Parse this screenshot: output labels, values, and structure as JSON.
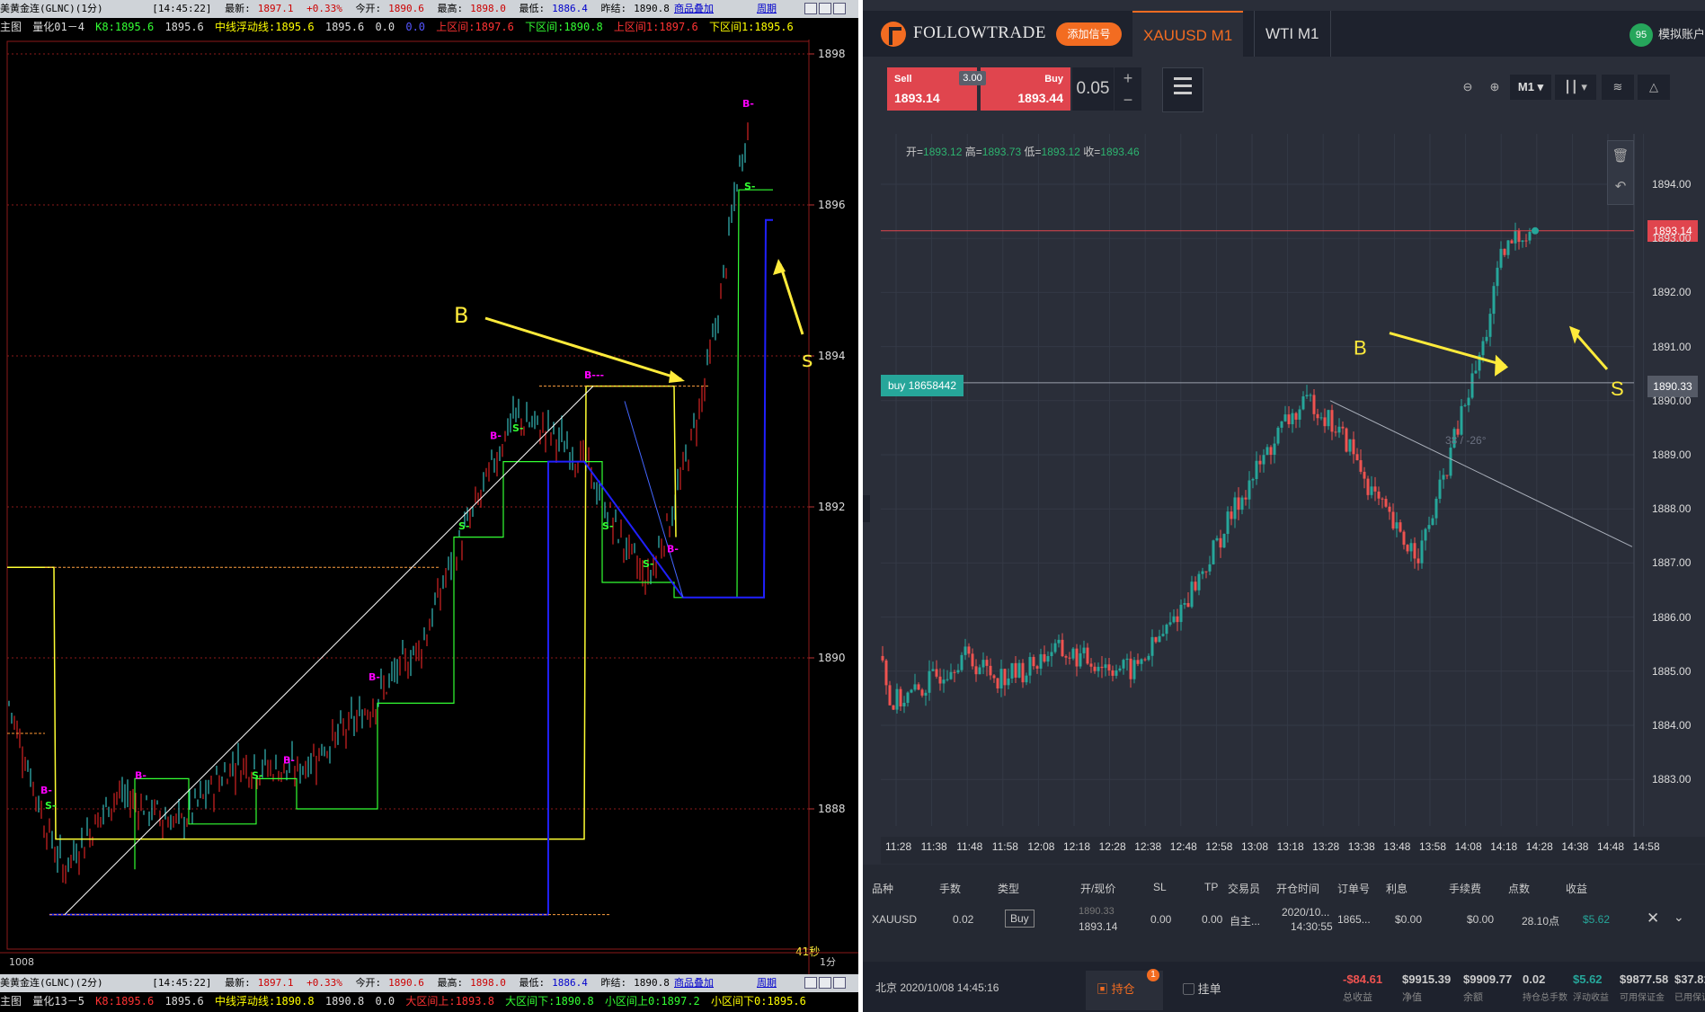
{
  "left": {
    "header1": {
      "title": "美黄金连(GLNC)(1分)",
      "time": "[14:45:22]",
      "latest_label": "最新:",
      "latest": "1897.1",
      "change": "+0.33%",
      "open_label": "今开:",
      "open": "1890.6",
      "high_label": "最高:",
      "high": "1898.0",
      "low_label": "最低:",
      "low": "1886.4",
      "prev_label": "昨结:",
      "prev": "1890.8",
      "overlay_btn": "商品叠加",
      "period_btn": "周期"
    },
    "indicator1": {
      "main": "主图",
      "name": "量化01－4",
      "k8": "K8:1895.6",
      "v1": "1895.6",
      "mid": "中线浮动线:1895.6",
      "v2": "1895.6",
      "v3": "0.0",
      "v4": "0.0",
      "upper": "上区间:1897.6",
      "lower": "下区间:1890.8",
      "upper1": "上区间1:1897.6",
      "lower1": "下区间1:1895.6"
    },
    "y_ticks": [
      "1898",
      "1896",
      "1894",
      "1892",
      "1890",
      "1888"
    ],
    "b_label": "B",
    "s_label": "s",
    "corner_num": "1008",
    "timer": "41秒",
    "period_label": "1分",
    "header2": {
      "title": "美黄金连(GLNC)(2分)",
      "time": "[14:45:22]",
      "latest_label": "最新:",
      "latest": "1897.1",
      "change": "+0.33%",
      "open_label": "今开:",
      "open": "1890.6",
      "high_label": "最高:",
      "high": "1898.0",
      "low_label": "最低:",
      "low": "1886.4",
      "prev_label": "昨结:",
      "prev": "1890.8",
      "overlay_btn": "商品叠加",
      "period_btn": "周期"
    },
    "indicator2": {
      "main": "主图",
      "name": "量化13－5",
      "k8": "K8:1895.6",
      "v1": "1895.6",
      "mid": "中线浮动线:1890.8",
      "v2": "1890.8",
      "v3": "0.0",
      "big_up": "大区间上:1893.8",
      "big_down": "大区间下:1890.8",
      "small_up": "小区间上0:1897.2",
      "small_down": "小区间下0:1895.6"
    },
    "bottom_period": "2分"
  },
  "right": {
    "brand": "FOLLOWTRADE",
    "add_signal": "添加信号",
    "tabs": [
      "XAUUSD M1",
      "WTI M1"
    ],
    "account_badge": "95",
    "account_label": "模拟账户",
    "sell_label": "Sell",
    "sell_price": "1893.14",
    "buy_label": "Buy",
    "buy_price": "1893.44",
    "spread": "3.00",
    "lots": "0.05",
    "timeframe": "M1",
    "ohlc": {
      "open_label": "开=",
      "open": "1893.12",
      "high_label": "高=",
      "high": "1893.73",
      "low_label": "低=",
      "low": "1893.12",
      "close_label": "收=",
      "close": "1893.46"
    },
    "y_ticks": [
      "1894.00",
      "1893.00",
      "1892.00",
      "1891.00",
      "1890.00",
      "1889.00",
      "1888.00",
      "1887.00",
      "1886.00",
      "1885.00",
      "1884.00",
      "1883.00"
    ],
    "x_ticks": [
      "11:28",
      "11:38",
      "11:48",
      "11:58",
      "12:08",
      "12:18",
      "12:28",
      "12:38",
      "12:48",
      "12:58",
      "13:08",
      "13:18",
      "13:28",
      "13:38",
      "13:48",
      "13:58",
      "14:08",
      "14:18",
      "14:28",
      "14:38",
      "14:48",
      "14:58"
    ],
    "current_price_tag": "1893.14",
    "buy_line_tag": "1890.33",
    "buy_order_label": "buy 18658442",
    "trendline_label": "38 / -26°",
    "b_label": "B",
    "s_label": "S",
    "positions": {
      "headers": [
        "品种",
        "手数",
        "类型",
        "开/现价",
        "SL",
        "TP",
        "交易员",
        "开仓时间",
        "订单号",
        "利息",
        "手续费",
        "点数",
        "收益"
      ],
      "row": {
        "symbol": "XAUUSD",
        "lots": "0.02",
        "type": "Buy",
        "open_price": "1890.33",
        "current_price": "1893.14",
        "sl": "0.00",
        "tp": "0.00",
        "trader": "自主...",
        "open_date": "2020/10...",
        "open_time": "14:30:55",
        "order_no": "1865...",
        "interest": "$0.00",
        "fee": "$0.00",
        "points": "28.10点",
        "profit": "$5.62"
      }
    },
    "footer": {
      "datetime": "北京 2020/10/08 14:45:16",
      "positions_tab": "持仓",
      "positions_count": "1",
      "pending_tab": "挂单",
      "total_profit": "-$84.61",
      "total_profit_label": "总收益",
      "equity": "$9915.39",
      "equity_label": "净值",
      "balance": "$9909.77",
      "balance_label": "余额",
      "total_lots": "0.02",
      "total_lots_label": "持仓总手数",
      "floating": "$5.62",
      "floating_label": "浮动收益",
      "free_margin": "$9877.58",
      "free_margin_label": "可用保证金",
      "used_margin": "$37.81",
      "used_margin_label": "已用保证"
    },
    "colors": {
      "up": "#26a69a",
      "down": "#ef5350",
      "accent": "#f36c21",
      "arrow": "#ffeb3b"
    }
  }
}
